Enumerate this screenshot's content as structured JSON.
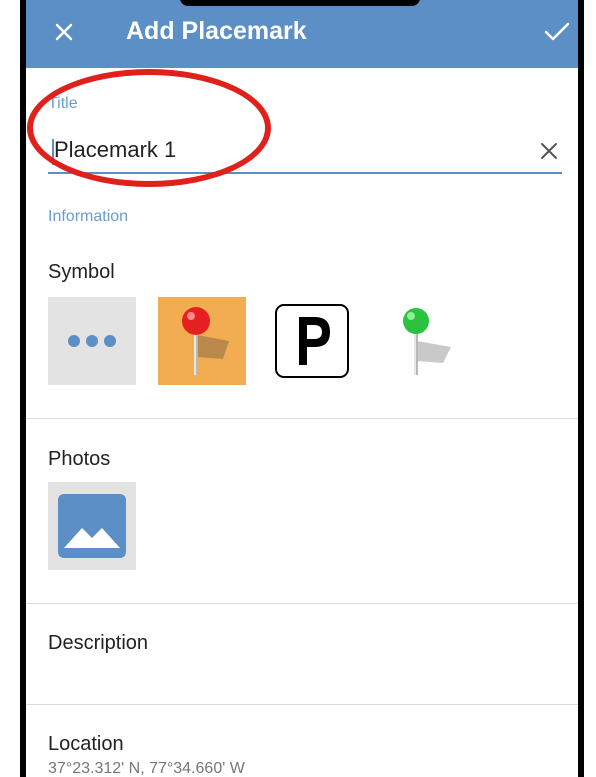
{
  "appbar": {
    "title": "Add Placemark",
    "close_icon": "close-icon",
    "confirm_icon": "check-icon",
    "color": "#5b8fc6"
  },
  "form": {
    "title_label": "Title",
    "title_value": "Placemark 1",
    "information_label": "Information",
    "symbol_label": "Symbol",
    "symbols": [
      {
        "name": "more-symbols",
        "icon": "more-dots-icon"
      },
      {
        "name": "red-pin",
        "icon": "red-pin-icon",
        "selected": true
      },
      {
        "name": "parking",
        "icon": "parking-icon",
        "glyph": "P"
      },
      {
        "name": "green-pin",
        "icon": "green-pin-icon"
      }
    ],
    "photos_label": "Photos",
    "photo_icon": "image-icon",
    "description_label": "Description",
    "location_label": "Location",
    "location_value": "37°23.312' N, 77°34.660' W"
  },
  "annotation": {
    "shape": "ellipse",
    "color": "#e0201b"
  }
}
